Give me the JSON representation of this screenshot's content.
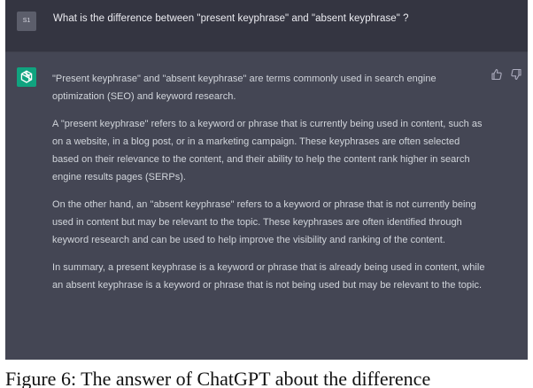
{
  "user": {
    "avatar_label": "S1",
    "question": "What is the difference between \"present keyphrase\" and \"absent keyphrase\" ?"
  },
  "assistant": {
    "avatar_icon": "openai-logo-icon",
    "paragraphs": [
      "\"Present keyphrase\" and \"absent keyphrase\" are terms commonly used in search engine optimization (SEO) and keyword research.",
      "A \"present keyphrase\" refers to a keyword or phrase that is currently being used in content, such as on a website, in a blog post, or in a marketing campaign. These keyphrases are often selected based on their relevance to the content, and their ability to help the content rank higher in search engine results pages (SERPs).",
      "On the other hand, an \"absent keyphrase\" refers to a keyword or phrase that is not currently being used in content but may be relevant to the topic. These keyphrases are often identified through keyword research and can be used to help improve the visibility and ranking of the content.",
      "In summary, a present keyphrase is a keyword or phrase that is already being used in content, while an absent keyphrase is a keyword or phrase that is not being used but may be relevant to the topic."
    ],
    "thumbs_up_icon": "thumbs-up-icon",
    "thumbs_down_icon": "thumbs-down-icon"
  },
  "caption": {
    "text": "Figure 6: The answer of ChatGPT about the difference"
  },
  "colors": {
    "user_bg": "#343541",
    "assistant_bg": "#444654",
    "accent": "#10a37f",
    "text": "#d1d5db"
  }
}
